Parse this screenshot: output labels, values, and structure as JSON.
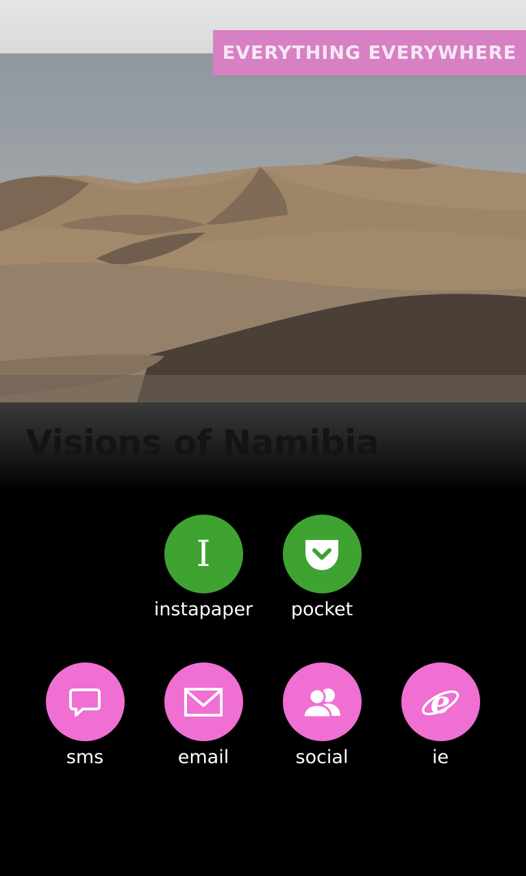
{
  "banner": {
    "label": "EVERYTHING EVERYWHERE"
  },
  "article": {
    "title": "Visions of Namibia"
  },
  "colors": {
    "banner_bg": "#d880c4",
    "read_later_green": "#3fa332",
    "share_pink": "#f06fd2"
  },
  "read_later": [
    {
      "label": "instapaper",
      "icon": "instapaper-icon"
    },
    {
      "label": "pocket",
      "icon": "pocket-icon"
    }
  ],
  "share": [
    {
      "label": "sms",
      "icon": "sms-icon"
    },
    {
      "label": "email",
      "icon": "email-icon"
    },
    {
      "label": "social",
      "icon": "social-icon"
    },
    {
      "label": "ie",
      "icon": "ie-icon"
    }
  ]
}
